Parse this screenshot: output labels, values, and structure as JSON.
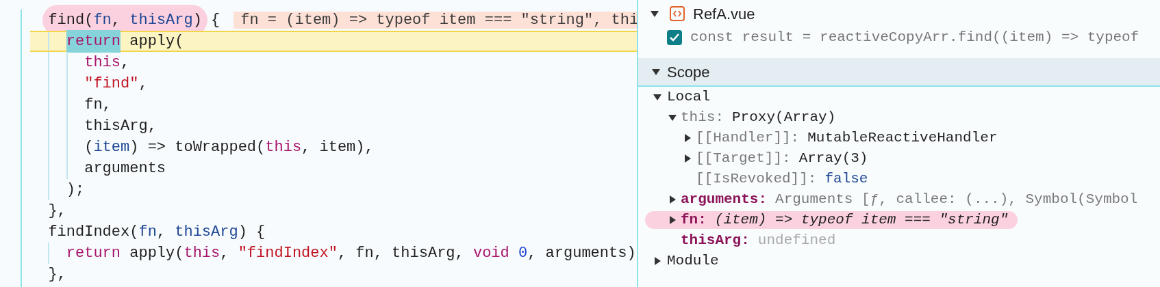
{
  "editor": {
    "lines": [
      {
        "current": false,
        "inline_value": "fn = (item) => typeof item === \"string\", thi",
        "tokens": [
          {
            "text": "  find(",
            "kind": "plain",
            "circled": true
          },
          {
            "text": "fn",
            "kind": "param",
            "circled": true
          },
          {
            "text": ", ",
            "kind": "plain",
            "circled": true
          },
          {
            "text": "thisArg",
            "kind": "param",
            "circled": true
          },
          {
            "text": ")",
            "kind": "plain",
            "circled": true
          },
          {
            "text": " {",
            "kind": "plain"
          }
        ]
      },
      {
        "current": true,
        "tokens": [
          {
            "text": "    return",
            "kind": "keyword",
            "marker": true
          },
          {
            "text": " apply(",
            "kind": "plain"
          }
        ]
      },
      {
        "current": false,
        "tokens": [
          {
            "text": "      this",
            "kind": "keyword"
          },
          {
            "text": ",",
            "kind": "plain"
          }
        ]
      },
      {
        "current": false,
        "tokens": [
          {
            "text": "      \"find\"",
            "kind": "string"
          },
          {
            "text": ",",
            "kind": "plain"
          }
        ]
      },
      {
        "current": false,
        "tokens": [
          {
            "text": "      fn,",
            "kind": "plain"
          }
        ]
      },
      {
        "current": false,
        "tokens": [
          {
            "text": "      thisArg,",
            "kind": "plain"
          }
        ]
      },
      {
        "current": false,
        "tokens": [
          {
            "text": "      (",
            "kind": "plain"
          },
          {
            "text": "item",
            "kind": "param"
          },
          {
            "text": ") => toWrapped(",
            "kind": "plain"
          },
          {
            "text": "this",
            "kind": "keyword"
          },
          {
            "text": ", item),",
            "kind": "plain"
          }
        ]
      },
      {
        "current": false,
        "tokens": [
          {
            "text": "      arguments",
            "kind": "plain"
          }
        ]
      },
      {
        "current": false,
        "tokens": [
          {
            "text": "    );",
            "kind": "plain"
          }
        ]
      },
      {
        "current": false,
        "tokens": [
          {
            "text": "  },",
            "kind": "plain"
          }
        ]
      },
      {
        "current": false,
        "tokens": [
          {
            "text": "  findIndex(",
            "kind": "plain"
          },
          {
            "text": "fn",
            "kind": "param"
          },
          {
            "text": ", ",
            "kind": "plain"
          },
          {
            "text": "thisArg",
            "kind": "param"
          },
          {
            "text": ") {",
            "kind": "plain"
          }
        ]
      },
      {
        "current": false,
        "tokens": [
          {
            "text": "    return",
            "kind": "keyword"
          },
          {
            "text": " apply(",
            "kind": "plain"
          },
          {
            "text": "this",
            "kind": "keyword"
          },
          {
            "text": ", ",
            "kind": "plain"
          },
          {
            "text": "\"findIndex\"",
            "kind": "string"
          },
          {
            "text": ", fn, thisArg, ",
            "kind": "plain"
          },
          {
            "text": "void",
            "kind": "keyword"
          },
          {
            "text": " 0",
            "kind": "number"
          },
          {
            "text": ", arguments)",
            "kind": "plain"
          }
        ]
      },
      {
        "current": false,
        "tokens": [
          {
            "text": "  },",
            "kind": "plain"
          }
        ]
      }
    ]
  },
  "breakpoints": {
    "file": {
      "label": "RefA.vue",
      "expanded": true
    },
    "item": {
      "checked": true,
      "code": "const result = reactiveCopyArr.find((item) => typeof"
    }
  },
  "scope": {
    "label": "Scope",
    "expanded": true,
    "sections": [
      {
        "label": "Local",
        "expanded": true,
        "children": [
          {
            "name": {
              "text": "this:",
              "kind": "dim"
            },
            "value": {
              "text": "Proxy(Array)",
              "kind": "plain"
            },
            "expanded": true,
            "children": [
              {
                "name": {
                  "text": "[[Handler]]:",
                  "kind": "dim"
                },
                "value": {
                  "text": "MutableReactiveHandler",
                  "kind": "plain"
                },
                "expanded": false
              },
              {
                "name": {
                  "text": "[[Target]]:",
                  "kind": "dim"
                },
                "value": {
                  "text": "Array(3)",
                  "kind": "plain"
                },
                "expanded": false
              },
              {
                "name": {
                  "text": "[[IsRevoked]]:",
                  "kind": "dim"
                },
                "value": {
                  "text": "false",
                  "kind": "keyword"
                }
              }
            ]
          },
          {
            "name": {
              "text": "arguments:",
              "kind": "own"
            },
            "value": {
              "text": "Arguments [ƒ, callee: (...), Symbol(Symbol",
              "kind": "preview"
            },
            "expanded": false
          },
          {
            "name": {
              "text": "fn:",
              "kind": "own"
            },
            "value": {
              "text": "(item) => typeof item === \"string\"",
              "kind": "function"
            },
            "expanded": false,
            "circled": true
          },
          {
            "name": {
              "text": "thisArg:",
              "kind": "own"
            },
            "value": {
              "text": "undefined",
              "kind": "undefined"
            }
          }
        ]
      },
      {
        "label": "Module",
        "expanded": false
      }
    ]
  }
}
